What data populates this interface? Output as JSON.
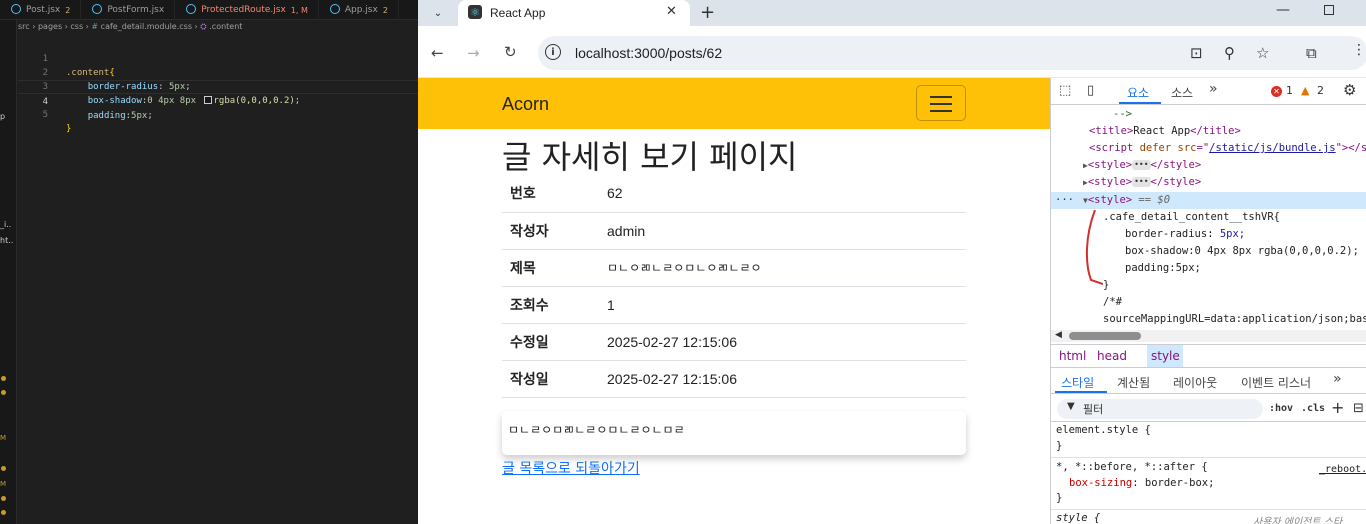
{
  "vscode": {
    "tabs": [
      {
        "label": "Post.jsx",
        "badge": "2",
        "kind": "jsx"
      },
      {
        "label": "PostForm.jsx",
        "badge": "",
        "kind": "jsx"
      },
      {
        "label": "ProtectedRoute.jsx",
        "badge": "1, M",
        "kind": "jsx-red"
      },
      {
        "label": "App.jsx",
        "badge": "2",
        "kind": "jsx"
      }
    ],
    "breadcrumb": {
      "path": "src › pages › css ›",
      "file": "cafe_detail.module.css",
      "sep": "›",
      "symbol": ".content"
    },
    "lines": [
      {
        "n": "1",
        "selector": ".content",
        "brace": "{"
      },
      {
        "n": "2",
        "prop": "border-radius",
        "value": "5px"
      },
      {
        "n": "3",
        "prop": "box-shadow",
        "value": "0 4px 8px",
        "fn": "rgba(0,0,0,0.2)"
      },
      {
        "n": "4",
        "prop": "padding",
        "value": "5px"
      },
      {
        "n": "5",
        "brace": "}"
      }
    ],
    "side_fragments": [
      "p",
      "_i..",
      "ht.."
    ],
    "side_m": "M"
  },
  "browser": {
    "tab_title": "React App",
    "url": "localhost:3000/posts/62"
  },
  "page": {
    "brand": "Acorn",
    "title": "글 자세히 보기 페이지",
    "rows": [
      {
        "label": "번호",
        "value": "62"
      },
      {
        "label": "작성자",
        "value": "admin"
      },
      {
        "label": "제목",
        "value": "ㅁㄴㅇㄻㄴㄹㅇㅁㄴㅇㄻㄴㄹㅇ"
      },
      {
        "label": "조회수",
        "value": "1"
      },
      {
        "label": "수정일",
        "value": "2025-02-27 12:15:06"
      },
      {
        "label": "작성일",
        "value": "2025-02-27 12:15:06"
      }
    ],
    "content": "ㅁㄴㄹㅇㅁㄻㄴㄹㅇㅁㄴㄹㅇㄴㅁㄹ",
    "back_link": "글 목록으로 되돌아가기"
  },
  "devtools": {
    "tab_elements": "요소",
    "tab_sources": "소스",
    "errors": "1",
    "warnings": "2",
    "dom": {
      "comment_close": "-->",
      "title_tag": "title",
      "title_text": "React App",
      "script_tag": "script",
      "script_attr1": "defer",
      "script_attr2": "src",
      "script_src": "/static/js/bundle.js",
      "style_tag": "style",
      "sel_marker": "== $0",
      "rule_selector": ".cafe_detail_content__tshVR{",
      "rule_br_prop": "border-radius",
      "rule_br_val": "5px;",
      "rule_bs": "box-shadow:0 4px 8px rgba(0,0,0,0.2);",
      "rule_pad": "padding:5px;",
      "rule_close": "}",
      "comment_open": "/*#",
      "sourcemap": "sourceMappingURL=data:application/json;base64"
    },
    "crumbs": [
      "html",
      "head",
      "style"
    ],
    "subtabs": [
      "스타일",
      "계산됨",
      "레이아웃",
      "이벤트 리스너"
    ],
    "filter_placeholder": "필터",
    "hov": ":hov",
    "cls": ".cls",
    "rules": {
      "element_style": "element.style {",
      "close": "}",
      "universal": "*, *::before, *::after {",
      "reboot": "_reboot.",
      "bs_prop": "box-sizing",
      "bs_val": "border-box;",
      "style_open": "style {",
      "ua": "사용자 에이전트 스타"
    }
  },
  "colors": {
    "navbar": "#ffc107",
    "link": "#0d6efd",
    "devtools_accent": "#1a73e8"
  }
}
